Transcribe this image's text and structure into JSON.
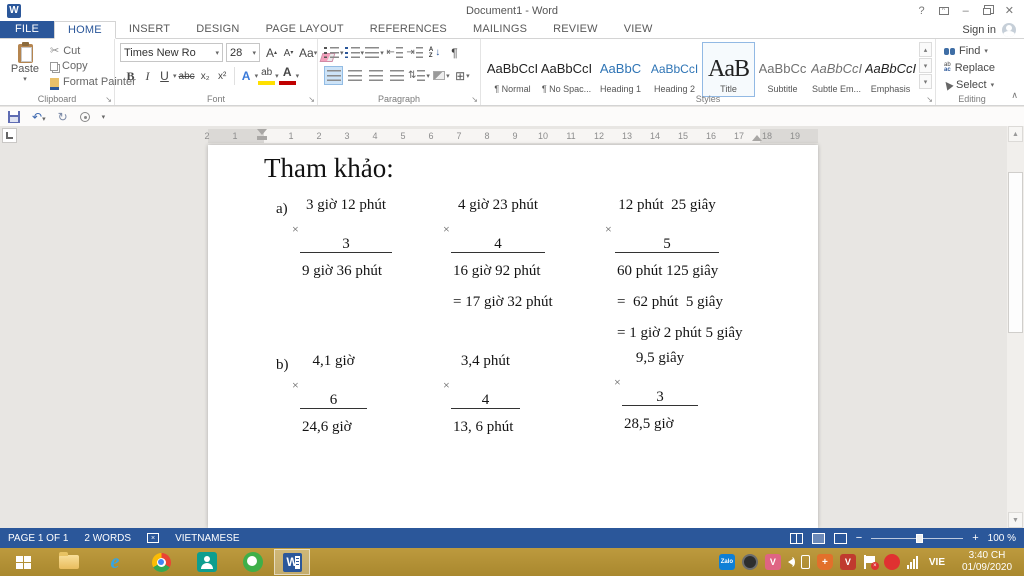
{
  "window": {
    "title": "Document1 - Word",
    "sign_in": "Sign in",
    "help": "?",
    "minimize": "–",
    "close": "✕"
  },
  "colors": {
    "accent": "#2b579a",
    "heading_blue": "#2e74b5",
    "status_bar": "#2b579a",
    "taskbar_gold": "#b2903a"
  },
  "ribbon": {
    "tabs": [
      {
        "label": "FILE"
      },
      {
        "label": "HOME"
      },
      {
        "label": "INSERT"
      },
      {
        "label": "DESIGN"
      },
      {
        "label": "PAGE LAYOUT"
      },
      {
        "label": "REFERENCES"
      },
      {
        "label": "MAILINGS"
      },
      {
        "label": "REVIEW"
      },
      {
        "label": "VIEW"
      }
    ],
    "clipboard": {
      "group_label": "Clipboard",
      "paste": "Paste",
      "cut": "Cut",
      "copy": "Copy",
      "format_painter": "Format Painter"
    },
    "font": {
      "group_label": "Font",
      "name": "Times New Ro",
      "size": "28",
      "grow": "A",
      "shrink": "A",
      "change_case": "Aa",
      "bold": "B",
      "italic": "I",
      "underline": "U",
      "strike": "abc",
      "subscript": "x₂",
      "superscript": "x²",
      "effects": "A",
      "highlight": "ab",
      "font_color": "A"
    },
    "paragraph": {
      "group_label": "Paragraph",
      "sort_a": "A",
      "sort_z": "Z",
      "pilcrow": "¶"
    },
    "styles": {
      "group_label": "Styles",
      "items": [
        {
          "preview": "AaBbCcI",
          "name": "¶ Normal"
        },
        {
          "preview": "AaBbCcI",
          "name": "¶ No Spac..."
        },
        {
          "preview": "AaBbC",
          "name": "Heading 1"
        },
        {
          "preview": "AaBbCcI",
          "name": "Heading 2"
        },
        {
          "preview": "AaB",
          "name": "Title"
        },
        {
          "preview": "AaBbCc",
          "name": "Subtitle"
        },
        {
          "preview": "AaBbCcI",
          "name": "Subtle Em..."
        },
        {
          "preview": "AaBbCcI",
          "name": "Emphasis"
        }
      ]
    },
    "editing": {
      "group_label": "Editing",
      "find": "Find",
      "replace": "Replace",
      "select": "Select"
    }
  },
  "ruler": {
    "cells": [
      "2",
      "1",
      "",
      "1",
      "2",
      "3",
      "4",
      "5",
      "6",
      "7",
      "8",
      "9",
      "10",
      "11",
      "12",
      "13",
      "14",
      "15",
      "16",
      "17",
      "18",
      "19"
    ]
  },
  "document": {
    "title": "Tham khảo:",
    "times": "×",
    "sections": [
      {
        "label": "a)",
        "problems": [
          {
            "operand": "3 giờ 12 phút",
            "multiplier": "3",
            "results": [
              "9 giờ 36 phút"
            ]
          },
          {
            "operand": "4 giờ 23 phút",
            "multiplier": "4",
            "results": [
              "16 giờ 92 phút",
              "= 17 giờ 32 phút"
            ]
          },
          {
            "operand": "12 phút  25 giây",
            "multiplier": "5",
            "results": [
              "60 phút 125 giây",
              "=  62 phút  5 giây",
              "= 1 giờ 2 phút 5 giây"
            ]
          }
        ]
      },
      {
        "label": "b)",
        "problems": [
          {
            "operand": "4,1 giờ",
            "multiplier": "6",
            "results": [
              "24,6 giờ"
            ]
          },
          {
            "operand": "3,4 phút",
            "multiplier": "4",
            "results": [
              "13, 6 phút"
            ]
          },
          {
            "operand": "9,5 giây",
            "multiplier": "3",
            "results": [
              "28,5 giờ"
            ]
          }
        ]
      }
    ]
  },
  "status_bar": {
    "page": "PAGE 1 OF 1",
    "words": "2 WORDS",
    "language": "VIETNAMESE",
    "zoom_level": "100 %"
  },
  "taskbar": {
    "tray_v1": "V",
    "tray_v2": "V",
    "language": "VIE",
    "time": "3:40 CH",
    "date": "01/09/2020"
  }
}
